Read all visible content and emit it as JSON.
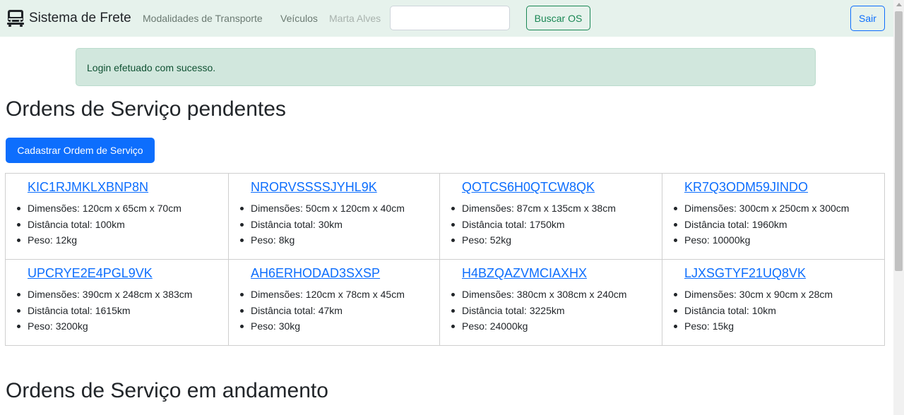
{
  "navbar": {
    "brand": "Sistema de Frete",
    "links": [
      "Modalidades de Transporte",
      "Veículos"
    ],
    "user": "Marta Alves",
    "search_value": "",
    "search_button": "Buscar OS",
    "logout_button": "Sair"
  },
  "alert": "Login efetuado com sucesso.",
  "pending": {
    "heading": "Ordens de Serviço pendentes",
    "new_button": "Cadastrar Ordem de Serviço",
    "orders": [
      {
        "code": "KIC1RJMKLXBNP8N",
        "dimensions": "Dimensões: 120cm x 65cm x 70cm",
        "distance": "Distância total: 100km",
        "weight": "Peso: 12kg"
      },
      {
        "code": "NRORVSSSSJYHL9K",
        "dimensions": "Dimensões: 50cm x 120cm x 40cm",
        "distance": "Distância total: 30km",
        "weight": "Peso: 8kg"
      },
      {
        "code": "QOTCS6H0QTCW8QK",
        "dimensions": "Dimensões: 87cm x 135cm x 38cm",
        "distance": "Distância total: 1750km",
        "weight": "Peso: 52kg"
      },
      {
        "code": "KR7Q3ODM59JINDO",
        "dimensions": "Dimensões: 300cm x 250cm x 300cm",
        "distance": "Distância total: 1960km",
        "weight": "Peso: 10000kg"
      },
      {
        "code": "UPCRYE2E4PGL9VK",
        "dimensions": "Dimensões: 390cm x 248cm x 383cm",
        "distance": "Distância total: 1615km",
        "weight": "Peso: 3200kg"
      },
      {
        "code": "AH6ERHODAD3SXSP",
        "dimensions": "Dimensões: 120cm x 78cm x 45cm",
        "distance": "Distância total: 47km",
        "weight": "Peso: 30kg"
      },
      {
        "code": "H4BZQAZVMCIAXHX",
        "dimensions": "Dimensões: 380cm x 308cm x 240cm",
        "distance": "Distância total: 3225km",
        "weight": "Peso: 24000kg"
      },
      {
        "code": "LJXSGTYF21UQ8VK",
        "dimensions": "Dimensões: 30cm x 90cm x 28cm",
        "distance": "Distância total: 10km",
        "weight": "Peso: 15kg"
      }
    ]
  },
  "in_progress": {
    "heading": "Ordens de Serviço em andamento"
  },
  "colors": {
    "navbar_bg": "#e6f2ec",
    "primary": "#0d6efd",
    "success": "#198754",
    "alert_bg": "#d1e7dd"
  },
  "icons": {
    "brand": "truck-front-icon"
  }
}
